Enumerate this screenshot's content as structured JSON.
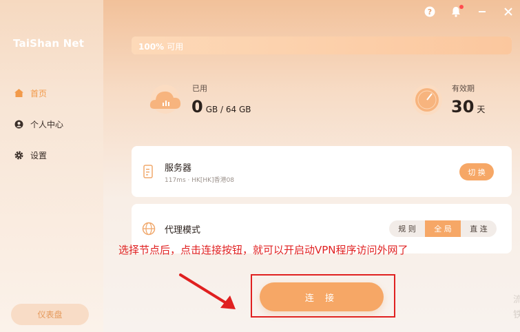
{
  "app": {
    "title": "TaiShan Net"
  },
  "sidebar": {
    "items": [
      {
        "label": "首页",
        "icon": "home-icon",
        "active": true
      },
      {
        "label": "个人中心",
        "icon": "user-icon",
        "active": false
      },
      {
        "label": "设置",
        "icon": "gear-icon",
        "active": false
      }
    ],
    "dashboard_label": "仪表盘"
  },
  "header": {
    "icons": [
      "help-icon",
      "bell-icon",
      "minimize-icon",
      "close-icon"
    ]
  },
  "usage": {
    "progress_percent": "100%",
    "progress_suffix": "可用",
    "progress_fraction": 1.0,
    "used_caption": "已用",
    "used_value": "0",
    "used_unit": "GB / 64 GB",
    "validity_caption": "有效期",
    "validity_value": "30",
    "validity_unit": "天"
  },
  "server": {
    "title": "服务器",
    "detail": "117ms · HK[HK]香港08",
    "switch_label": "切 换"
  },
  "proxy": {
    "title": "代理模式",
    "modes": [
      {
        "label": "规 则",
        "selected": false
      },
      {
        "label": "全 局",
        "selected": true
      },
      {
        "label": "直 连",
        "selected": false
      }
    ]
  },
  "annotation": {
    "text": "选择节点后，点击连接按钮，就可以开启动VPN程序访问外网了"
  },
  "connect": {
    "label": "连 接"
  },
  "edge": {
    "text": "流 铁"
  },
  "colors": {
    "accent": "#f6a766",
    "annotation": "#e02020",
    "active_nav": "#f29a4a"
  }
}
